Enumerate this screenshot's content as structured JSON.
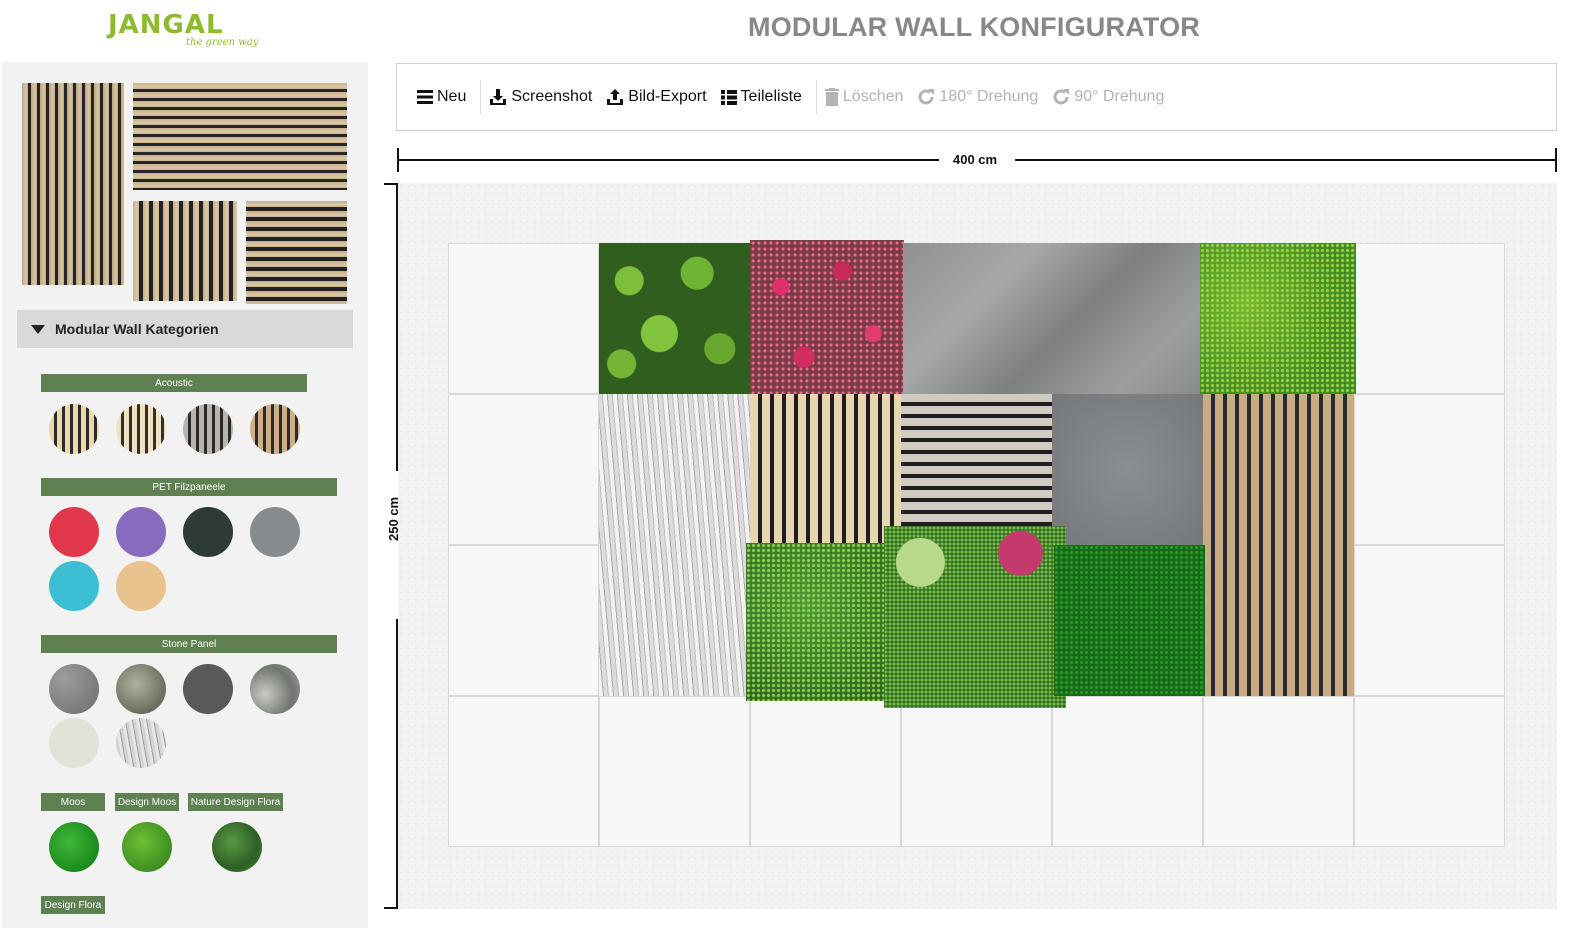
{
  "header": {
    "logo_text": "JANGAL",
    "logo_tagline": "the green way",
    "title": "MODULAR WALL KONFIGURATOR"
  },
  "sidebar": {
    "category_header": "Modular Wall Kategorien",
    "groups": {
      "acoustic": "Acoustic",
      "pet": "PET Filzpaneele",
      "stone": "Stone Panel",
      "moos": "Moos",
      "design_moos": "Design Moos",
      "nature_flora": "Nature Design Flora",
      "design_flora": "Design Flora"
    }
  },
  "toolbar": {
    "new": "Neu",
    "screenshot": "Screenshot",
    "export": "Bild-Export",
    "parts": "Teileliste",
    "delete": "Löschen",
    "rotate180": "180° Drehung",
    "rotate90": "90° Drehung"
  },
  "dimensions": {
    "width": "400 cm",
    "height": "250 cm"
  },
  "colors": {
    "brand_green": "#8dbb2f",
    "group_label_bg": "#5f8050",
    "title_grey": "#888888"
  }
}
